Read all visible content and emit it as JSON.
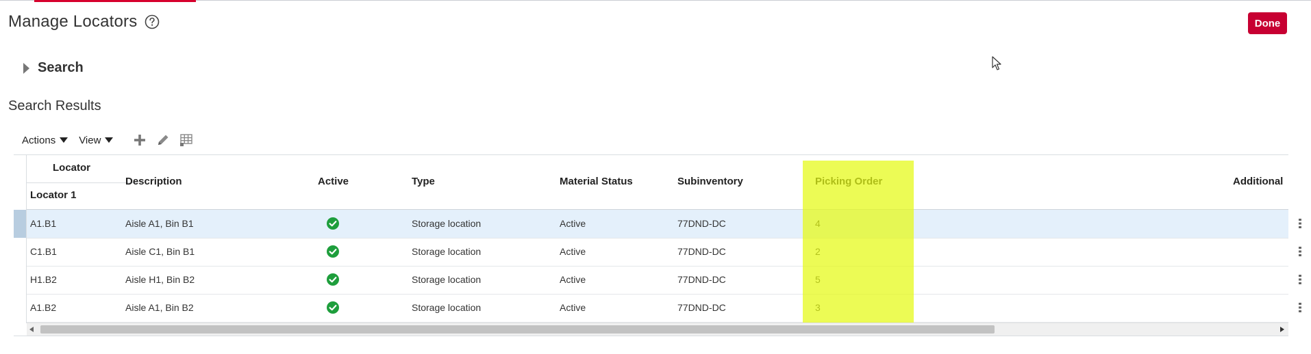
{
  "page": {
    "title": "Manage Locators",
    "done_label": "Done"
  },
  "search": {
    "label": "Search"
  },
  "results": {
    "title": "Search Results"
  },
  "toolbar": {
    "actions_label": "Actions",
    "view_label": "View",
    "icons": [
      "add-icon",
      "edit-pencil-icon",
      "freeze-columns-icon"
    ]
  },
  "table": {
    "header_group": "Locator",
    "columns": {
      "locator1": "Locator 1",
      "description": "Description",
      "active": "Active",
      "type": "Type",
      "material_status": "Material Status",
      "subinventory": "Subinventory",
      "picking_order": "Picking Order",
      "additional": "Additional"
    },
    "rows": [
      {
        "locator1": "A1.B1",
        "description": "Aisle A1, Bin B1",
        "active": true,
        "type": "Storage location",
        "material_status": "Active",
        "subinventory": "77DND-DC",
        "picking_order": "4"
      },
      {
        "locator1": "C1.B1",
        "description": "Aisle C1, Bin B1",
        "active": true,
        "type": "Storage location",
        "material_status": "Active",
        "subinventory": "77DND-DC",
        "picking_order": "2"
      },
      {
        "locator1": "H1.B2",
        "description": "Aisle H1, Bin B2",
        "active": true,
        "type": "Storage location",
        "material_status": "Active",
        "subinventory": "77DND-DC",
        "picking_order": "5"
      },
      {
        "locator1": "A1.B2",
        "description": "Aisle A1, Bin B2",
        "active": true,
        "type": "Storage location",
        "material_status": "Active",
        "subinventory": "77DND-DC",
        "picking_order": "3"
      }
    ],
    "selected_row": 0
  },
  "colors": {
    "accent": "#c70032",
    "highlight": "#e4fa14",
    "selected_row": "#e4f0fb",
    "active_check": "#1e9e3c"
  }
}
